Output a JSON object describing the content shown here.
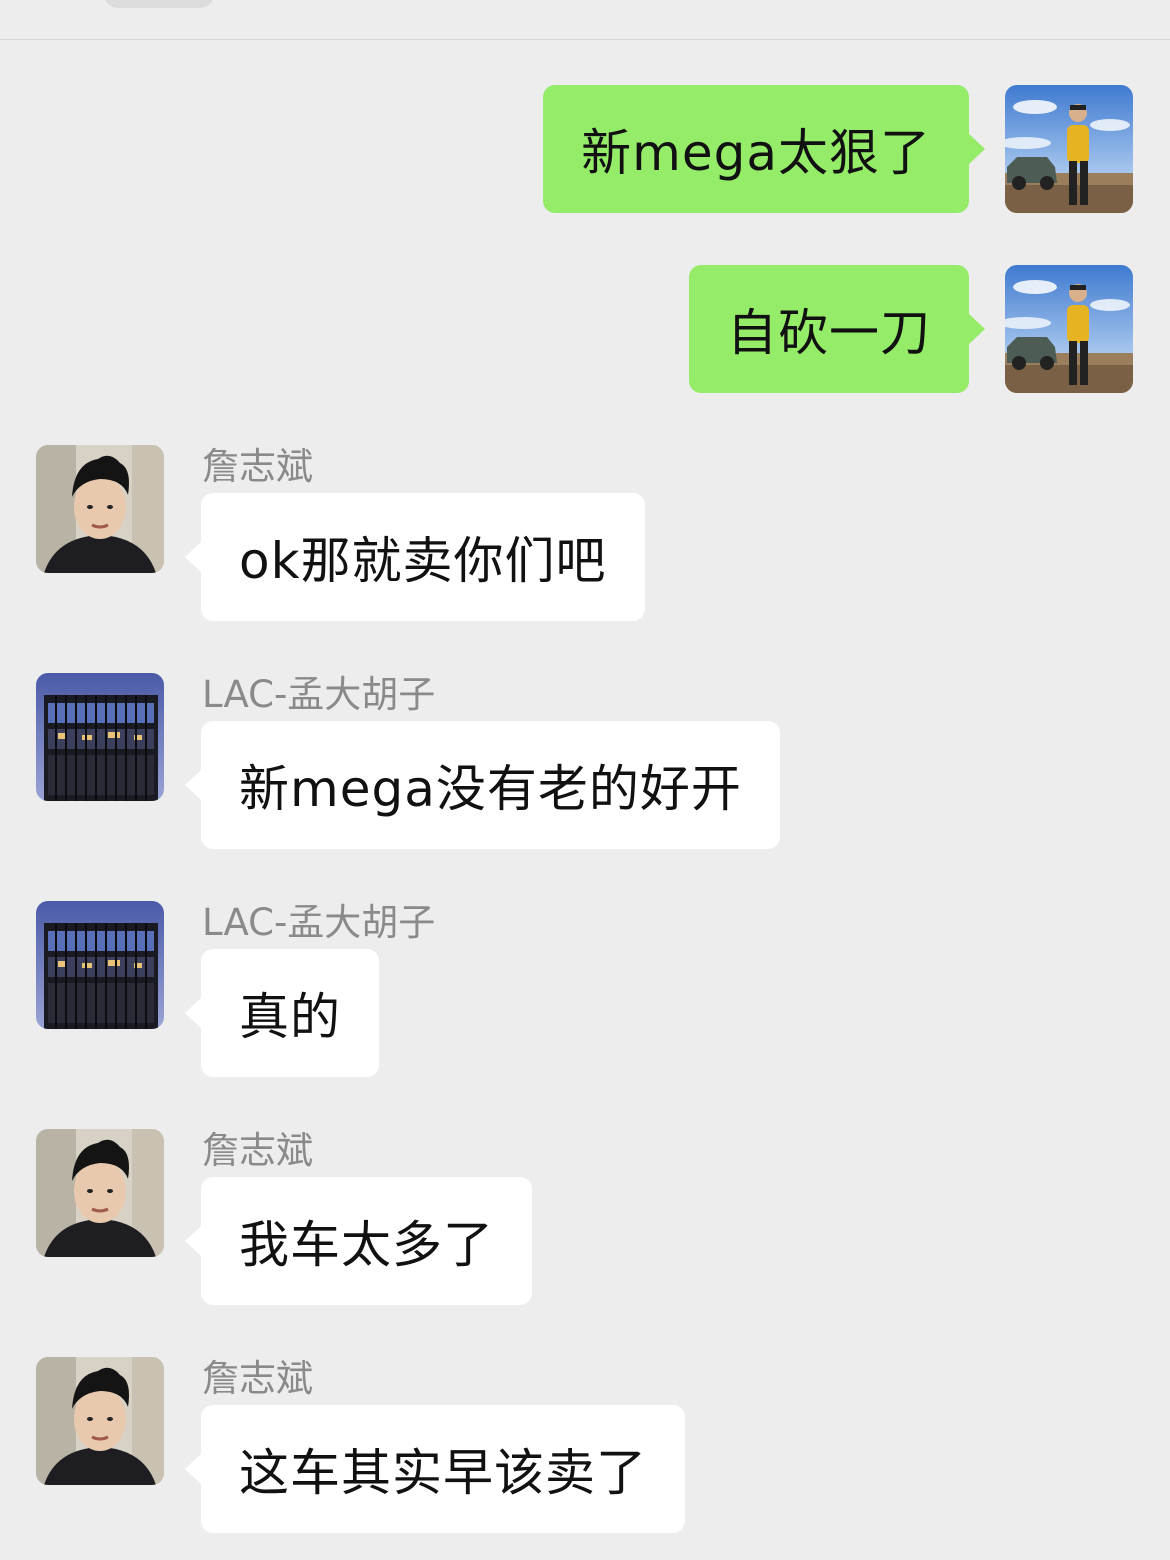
{
  "messages": [
    {
      "side": "me",
      "avatar": "self-landscape-avatar",
      "text": "新mega太狠了"
    },
    {
      "side": "me",
      "avatar": "self-landscape-avatar",
      "text": "自砍一刀"
    },
    {
      "side": "other",
      "sender": "詹志斌",
      "avatar": "man-portrait-avatar",
      "text": "ok那就卖你们吧"
    },
    {
      "side": "other",
      "sender": "LAC-孟大胡子",
      "avatar": "glass-building-avatar",
      "text": "新mega没有老的好开"
    },
    {
      "side": "other",
      "sender": "LAC-孟大胡子",
      "avatar": "glass-building-avatar",
      "text": "真的"
    },
    {
      "side": "other",
      "sender": "詹志斌",
      "avatar": "man-portrait-avatar",
      "text": "我车太多了"
    },
    {
      "side": "other",
      "sender": "詹志斌",
      "avatar": "man-portrait-avatar",
      "text": "这车其实早该卖了"
    }
  ],
  "colors": {
    "background": "#ededed",
    "my_bubble": "#95ec69",
    "other_bubble": "#ffffff",
    "sender_name": "#8a8a8a"
  }
}
